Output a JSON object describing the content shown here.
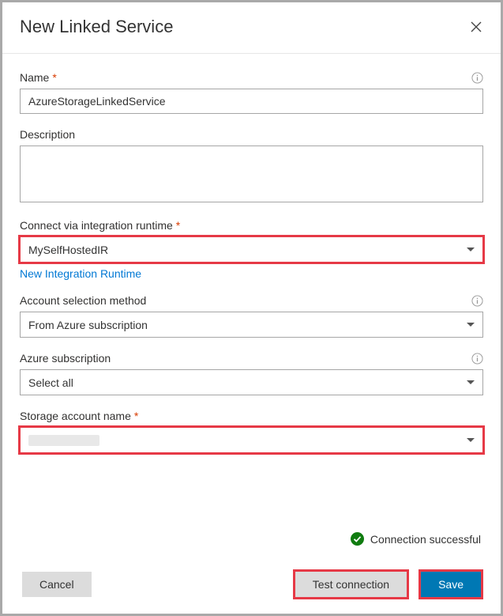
{
  "header": {
    "title": "New Linked Service"
  },
  "fields": {
    "name": {
      "label": "Name",
      "value": "AzureStorageLinkedService"
    },
    "description": {
      "label": "Description",
      "value": ""
    },
    "runtime": {
      "label": "Connect via integration runtime",
      "value": "MySelfHostedIR",
      "new_link": "New Integration Runtime"
    },
    "acct_method": {
      "label": "Account selection method",
      "value": "From Azure subscription"
    },
    "subscription": {
      "label": "Azure subscription",
      "value": "Select all"
    },
    "storage": {
      "label": "Storage account name",
      "value": ""
    }
  },
  "status": {
    "text": "Connection successful"
  },
  "buttons": {
    "cancel": "Cancel",
    "test": "Test connection",
    "save": "Save"
  }
}
